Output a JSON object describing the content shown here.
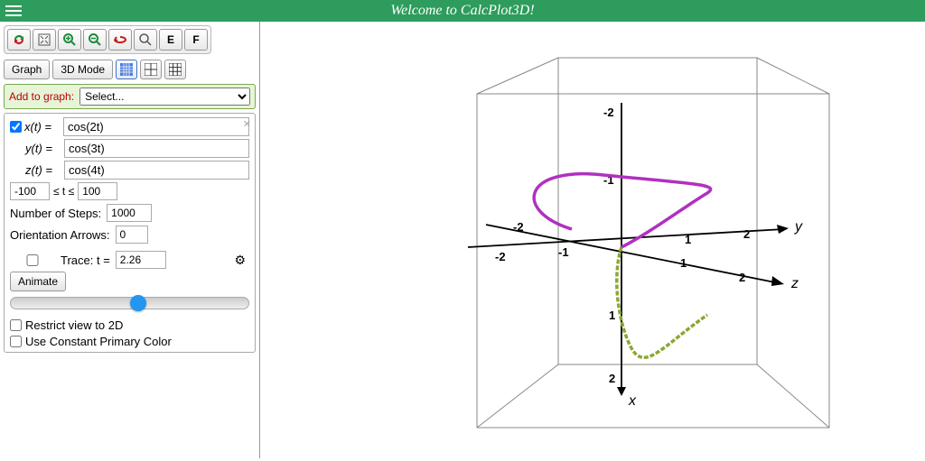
{
  "header": {
    "title": "Welcome to CalcPlot3D!"
  },
  "toolbar": {
    "icons": [
      "rotate",
      "fit",
      "zoom-in",
      "zoom-out",
      "undo",
      "search"
    ],
    "letters": {
      "e": "E",
      "f": "F"
    }
  },
  "controls": {
    "graph_btn": "Graph",
    "mode_btn": "3D Mode",
    "add_label": "Add to graph:",
    "select_placeholder": "Select..."
  },
  "equations": {
    "enable": true,
    "x_label": "x(t) =",
    "x_val": "cos(2t)",
    "y_label": "y(t) =",
    "y_val": "cos(3t)",
    "z_label": "z(t) =",
    "z_val": "cos(4t)"
  },
  "bounds": {
    "tmin": "-100",
    "rel": "≤ t ≤",
    "tmax": "100"
  },
  "steps": {
    "label": "Number of Steps:",
    "val": "1000"
  },
  "arrows": {
    "label": "Orientation Arrows:",
    "val": "0"
  },
  "trace": {
    "label": "Trace: t =",
    "val": "2.26",
    "animate": "Animate"
  },
  "checks": {
    "restrict": "Restrict view to 2D",
    "color": "Use Constant Primary Color"
  },
  "axes": {
    "x_name": "x",
    "y_name": "y",
    "z_name": "z",
    "ticks": [
      "-2",
      "-1",
      "1",
      "2"
    ]
  },
  "chart_data": {
    "type": "line",
    "title": "3D parametric curve",
    "parametric": {
      "x": "cos(2t)",
      "y": "cos(3t)",
      "z": "cos(4t)",
      "t_range": [
        -100,
        100
      ],
      "steps": 1000
    },
    "axes_range": {
      "x": [
        -2,
        2
      ],
      "y": [
        -2,
        2
      ],
      "z": [
        -2,
        2
      ]
    }
  }
}
